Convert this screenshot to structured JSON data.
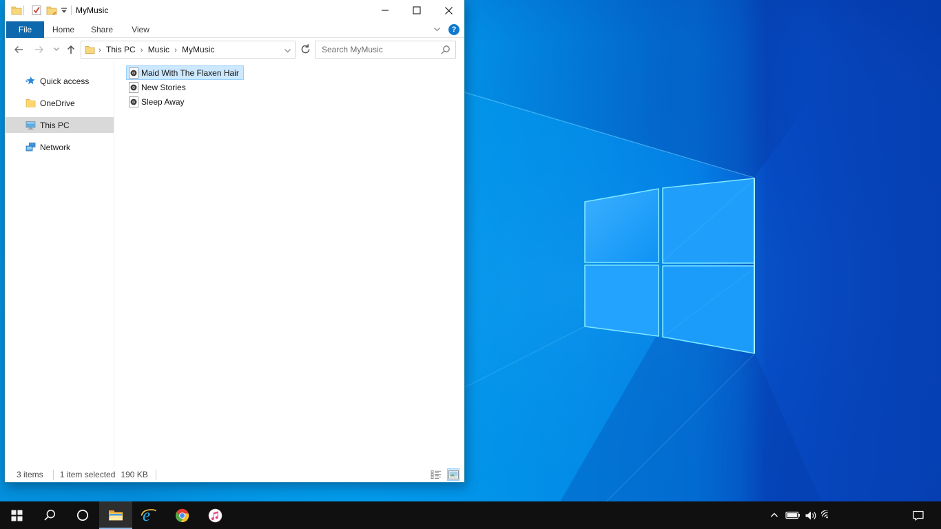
{
  "window": {
    "title": "MyMusic",
    "tabs": [
      {
        "label": "File",
        "active": true
      },
      {
        "label": "Home",
        "active": false
      },
      {
        "label": "Share",
        "active": false
      },
      {
        "label": "View",
        "active": false
      }
    ],
    "address": {
      "crumbs": [
        "This PC",
        "Music",
        "MyMusic"
      ],
      "search_placeholder": "Search MyMusic"
    },
    "sidebar": [
      {
        "label": "Quick access",
        "icon": "star-icon",
        "selected": false
      },
      {
        "label": "OneDrive",
        "icon": "onedrive-folder-icon",
        "selected": false
      },
      {
        "label": "This PC",
        "icon": "computer-icon",
        "selected": true
      },
      {
        "label": "Network",
        "icon": "network-icon",
        "selected": false
      }
    ],
    "files": [
      {
        "name": "Maid With The Flaxen Hair",
        "icon": "audio-file-icon",
        "selected": true
      },
      {
        "name": "New Stories",
        "icon": "audio-file-icon",
        "selected": false
      },
      {
        "name": "Sleep Away",
        "icon": "audio-file-icon",
        "selected": false
      }
    ],
    "statusbar": {
      "count": "3 items",
      "selection": "1 item selected",
      "size": "190 KB"
    }
  },
  "taskbar": {
    "items": [
      {
        "name": "start"
      },
      {
        "name": "search"
      },
      {
        "name": "cortana"
      },
      {
        "name": "file-explorer",
        "active": true
      },
      {
        "name": "internet-explorer"
      },
      {
        "name": "chrome"
      },
      {
        "name": "itunes"
      }
    ],
    "tray": [
      "hidden-icons-chevron",
      "battery",
      "volume",
      "wifi",
      "action-center"
    ]
  },
  "colors": {
    "file_tab": "#0e68ae",
    "selection_fill": "#cce8ff",
    "selection_border": "#99d1ff",
    "sidebar_selected": "#d9d9d9",
    "taskbar": "#101010",
    "taskbar_active_underline": "#85b5de",
    "desktop_bright": "#02a2ec",
    "desktop_dark": "#0540b4",
    "logo_edge": "#7ee7ff"
  }
}
